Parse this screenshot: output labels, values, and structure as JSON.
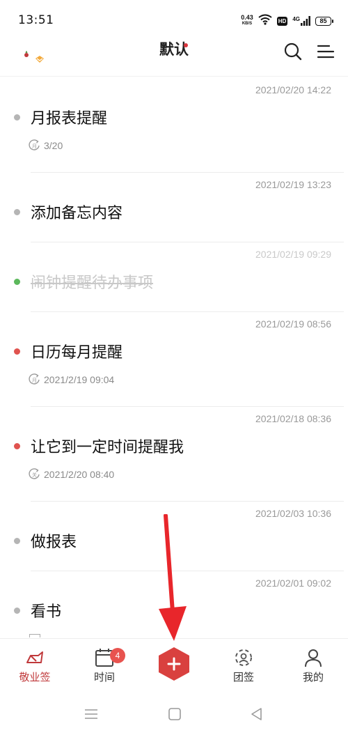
{
  "status_bar": {
    "time": "13:51",
    "net_speed": "0.43",
    "net_unit": "KB/S",
    "hd": "HD",
    "network": "4G",
    "battery": "85"
  },
  "header": {
    "title": "默认",
    "icons": {
      "logo": "app-logo-icon",
      "search": "search-icon",
      "menu": "menu-icon"
    }
  },
  "memos": [
    {
      "date": "2021/02/20 14:22",
      "title": "月报表提醒",
      "status": "pending",
      "dot_color": "#b5b5b5",
      "repeat_icon": "repeat-monthly-icon",
      "sub": "3/20"
    },
    {
      "date": "2021/02/19 13:23",
      "title": "添加备忘内容",
      "status": "pending",
      "dot_color": "#b5b5b5",
      "repeat_icon": "",
      "sub": ""
    },
    {
      "date": "2021/02/19 09:29",
      "title": "闹钟提醒待办事项",
      "status": "done",
      "dot_color": "#5cb85c",
      "repeat_icon": "",
      "sub": ""
    },
    {
      "date": "2021/02/19 08:56",
      "title": "日历每月提醒",
      "status": "pending",
      "dot_color": "#e0534f",
      "repeat_icon": "repeat-monthly-icon",
      "sub": "2021/2/19 09:04"
    },
    {
      "date": "2021/02/18 08:36",
      "title": "让它到一定时间提醒我",
      "status": "pending",
      "dot_color": "#e0534f",
      "repeat_icon": "repeat-off-icon",
      "sub": "2021/2/20 08:40"
    },
    {
      "date": "2021/02/03 10:36",
      "title": "做报表",
      "status": "pending",
      "dot_color": "#b5b5b5",
      "repeat_icon": "",
      "sub": ""
    },
    {
      "date": "2021/02/01 09:02",
      "title": "看书",
      "status": "pending",
      "dot_color": "#b5b5b5",
      "repeat_icon": "",
      "sub": ""
    }
  ],
  "tabs": [
    {
      "label": "敬业签",
      "icon": "note-tag-icon",
      "active": true
    },
    {
      "label": "时间",
      "icon": "calendar-icon",
      "active": false,
      "badge": "4"
    },
    {
      "label": "",
      "icon": "add-icon",
      "active": false
    },
    {
      "label": "团签",
      "icon": "team-icon",
      "active": false
    },
    {
      "label": "我的",
      "icon": "profile-icon",
      "active": false
    }
  ],
  "system_nav": {
    "icons": [
      "recent-apps-icon",
      "home-icon",
      "back-icon"
    ]
  },
  "colors": {
    "accent": "#c0393b",
    "add_button": "#d9413f",
    "annotation_arrow": "#e8262b",
    "text_muted": "#999999"
  }
}
